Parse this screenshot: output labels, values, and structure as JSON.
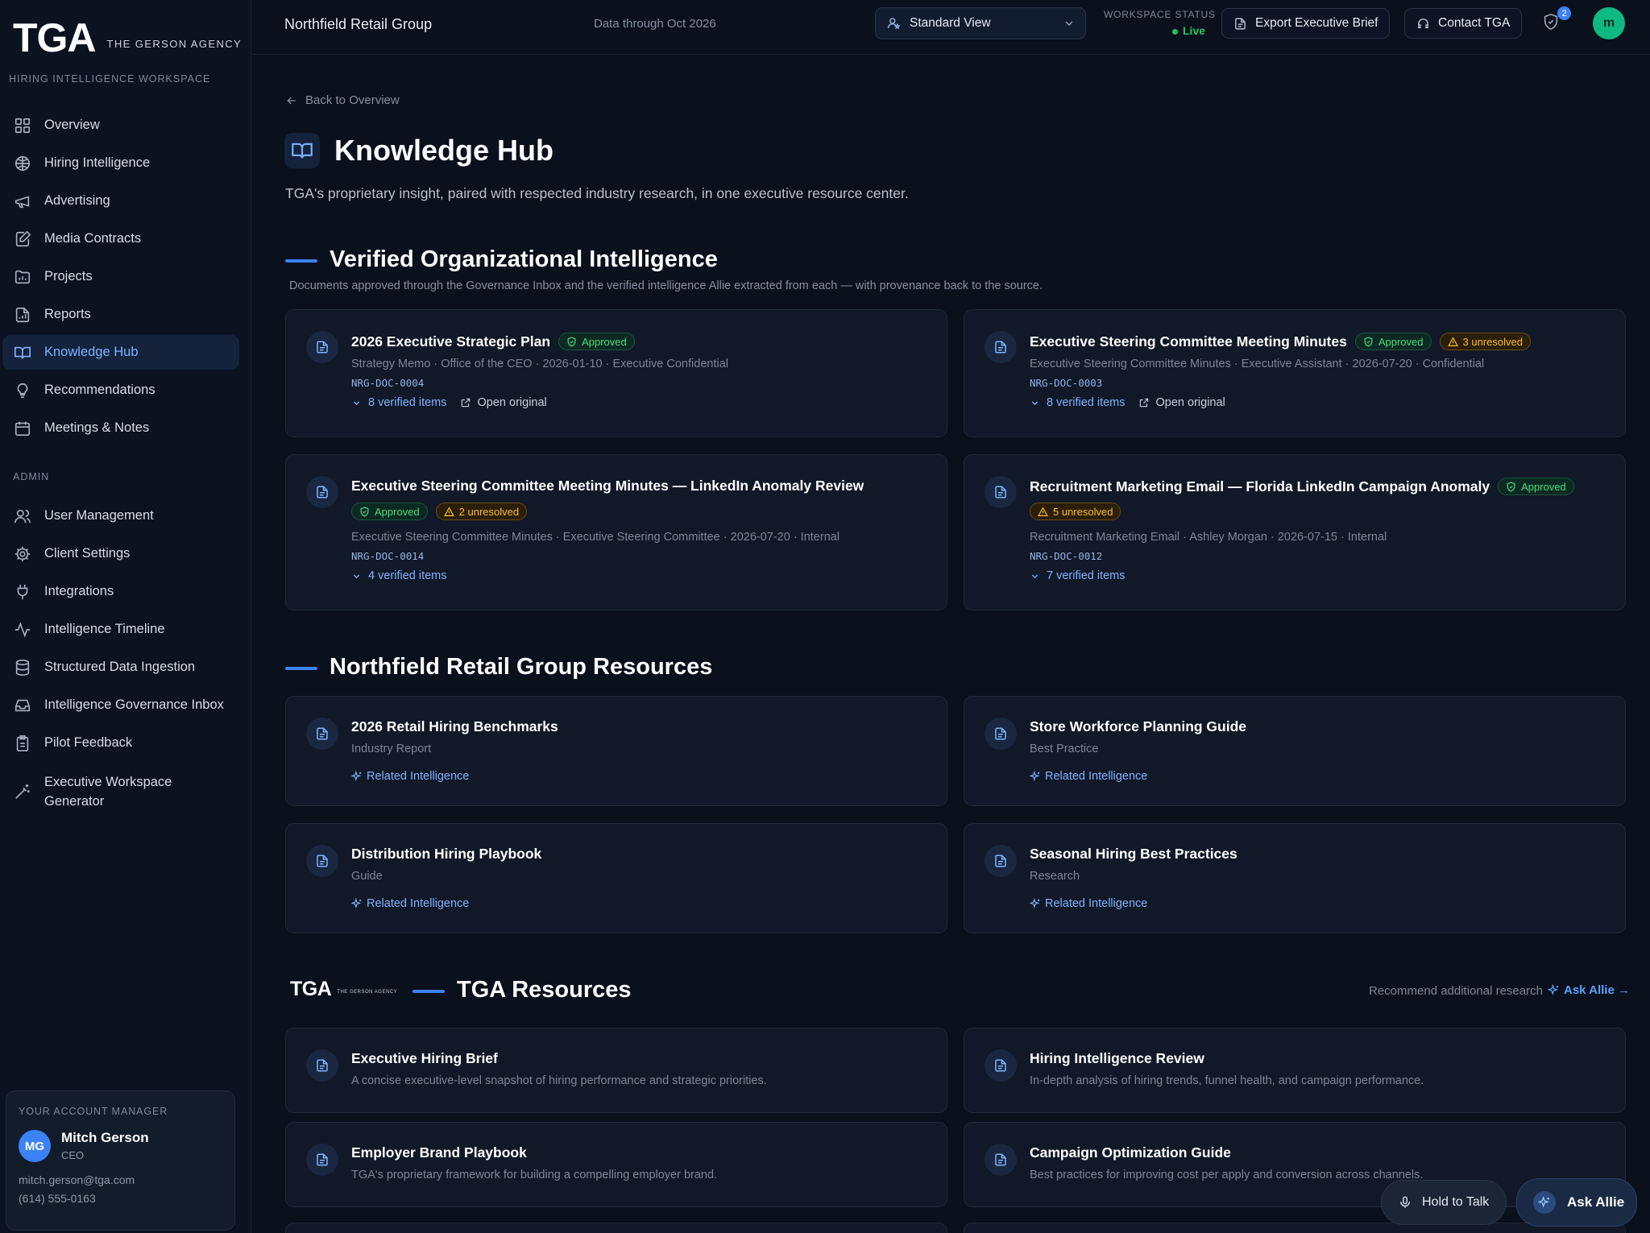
{
  "brand": {
    "mark": "TGA",
    "agency": "THE GERSON AGENCY",
    "workspace_label": "HIRING INTELLIGENCE WORKSPACE"
  },
  "nav": {
    "items": [
      {
        "label": "Overview",
        "icon": "grid-icon"
      },
      {
        "label": "Hiring Intelligence",
        "icon": "brain-icon"
      },
      {
        "label": "Advertising",
        "icon": "megaphone-icon"
      },
      {
        "label": "Media Contracts",
        "icon": "edit-doc-icon"
      },
      {
        "label": "Projects",
        "icon": "folder-chart-icon"
      },
      {
        "label": "Reports",
        "icon": "report-icon"
      },
      {
        "label": "Knowledge Hub",
        "icon": "book-icon",
        "active": true
      },
      {
        "label": "Recommendations",
        "icon": "lightbulb-icon"
      },
      {
        "label": "Meetings & Notes",
        "icon": "calendar-icon"
      }
    ],
    "admin_label": "ADMIN",
    "admin_items": [
      {
        "label": "User Management",
        "icon": "users-icon"
      },
      {
        "label": "Client Settings",
        "icon": "gear-icon"
      },
      {
        "label": "Integrations",
        "icon": "plug-icon"
      },
      {
        "label": "Intelligence Timeline",
        "icon": "activity-icon"
      },
      {
        "label": "Structured Data Ingestion",
        "icon": "database-icon"
      },
      {
        "label": "Intelligence Governance Inbox",
        "icon": "inbox-icon"
      },
      {
        "label": "Pilot Feedback",
        "icon": "clipboard-icon"
      },
      {
        "label": "Executive Workspace\nGenerator",
        "icon": "wand-icon"
      }
    ]
  },
  "account_manager": {
    "title": "YOUR ACCOUNT MANAGER",
    "initials": "MG",
    "name": "Mitch Gerson",
    "role": "CEO",
    "email": "mitch.gerson@tga.com",
    "phone": "(614) 555-0163"
  },
  "topbar": {
    "client": "Northfield Retail Group",
    "data_through": "Data through Oct 2026",
    "view": "Standard View",
    "status_label": "WORKSPACE STATUS",
    "status_value": "Live",
    "export_label": "Export Executive Brief",
    "contact_label": "Contact TGA",
    "notif_count": "2",
    "user_initial": "m"
  },
  "page": {
    "back": "Back to Overview",
    "title": "Knowledge Hub",
    "subtitle": "TGA's proprietary insight, paired with respected industry research, in one executive resource center."
  },
  "verified": {
    "title": "Verified Organizational Intelligence",
    "description": "Documents approved through the Governance Inbox and the verified intelligence Allie extracted from each — with provenance back to the source.",
    "docs": [
      {
        "title": "2026 Executive Strategic Plan",
        "approved": "Approved",
        "unresolved": "",
        "meta": "Strategy Memo · Office of the CEO · 2026-01-10 · Executive Confidential",
        "id": "NRG-DOC-0004",
        "verified": "8 verified items",
        "open": "Open original"
      },
      {
        "title": "Executive Steering Committee Meeting Minutes",
        "approved": "Approved",
        "unresolved": "3 unresolved",
        "meta": "Executive Steering Committee Minutes · Executive Assistant · 2026-07-20 · Confidential",
        "id": "NRG-DOC-0003",
        "verified": "8 verified items",
        "open": "Open original"
      },
      {
        "title": "Executive Steering Committee Meeting Minutes — LinkedIn Anomaly Review",
        "approved": "Approved",
        "unresolved": "2 unresolved",
        "meta": "Executive Steering Committee Minutes · Executive Steering Committee · 2026-07-20 · Internal",
        "id": "NRG-DOC-0014",
        "verified": "4 verified items",
        "open": ""
      },
      {
        "title": "Recruitment Marketing Email — Florida LinkedIn Campaign Anomaly",
        "approved": "Approved",
        "unresolved": "5 unresolved",
        "meta": "Recruitment Marketing Email · Ashley Morgan · 2026-07-15 · Internal",
        "id": "NRG-DOC-0012",
        "verified": "7 verified items",
        "open": ""
      }
    ]
  },
  "client_resources": {
    "title": "Northfield Retail Group Resources",
    "related_label": "Related Intelligence",
    "items": [
      {
        "title": "2026 Retail Hiring Benchmarks",
        "type": "Industry Report"
      },
      {
        "title": "Store Workforce Planning Guide",
        "type": "Best Practice"
      },
      {
        "title": "Distribution Hiring Playbook",
        "type": "Guide"
      },
      {
        "title": "Seasonal Hiring Best Practices",
        "type": "Research"
      }
    ]
  },
  "tga_resources": {
    "title": "TGA Resources",
    "logo_mark": "TGA",
    "logo_sub": "THE GERSON AGENCY",
    "recommend": "Recommend additional research",
    "ask_link": "Ask Allie →",
    "items": [
      {
        "title": "Executive Hiring Brief",
        "desc": "A concise executive-level snapshot of hiring performance and strategic priorities."
      },
      {
        "title": "Hiring Intelligence Review",
        "desc": "In-depth analysis of hiring trends, funnel health, and campaign performance."
      },
      {
        "title": "Employer Brand Playbook",
        "desc": "TGA's proprietary framework for building a compelling employer brand."
      },
      {
        "title": "Campaign Optimization Guide",
        "desc": "Best practices for improving cost per apply and conversion across channels."
      }
    ]
  },
  "floating": {
    "hold": "Hold to Talk",
    "ask": "Ask Allie"
  },
  "colors": {
    "accent": "#3b82f6",
    "approved": "#4ade80",
    "warning": "#fbbf24",
    "live": "#22c55e"
  }
}
